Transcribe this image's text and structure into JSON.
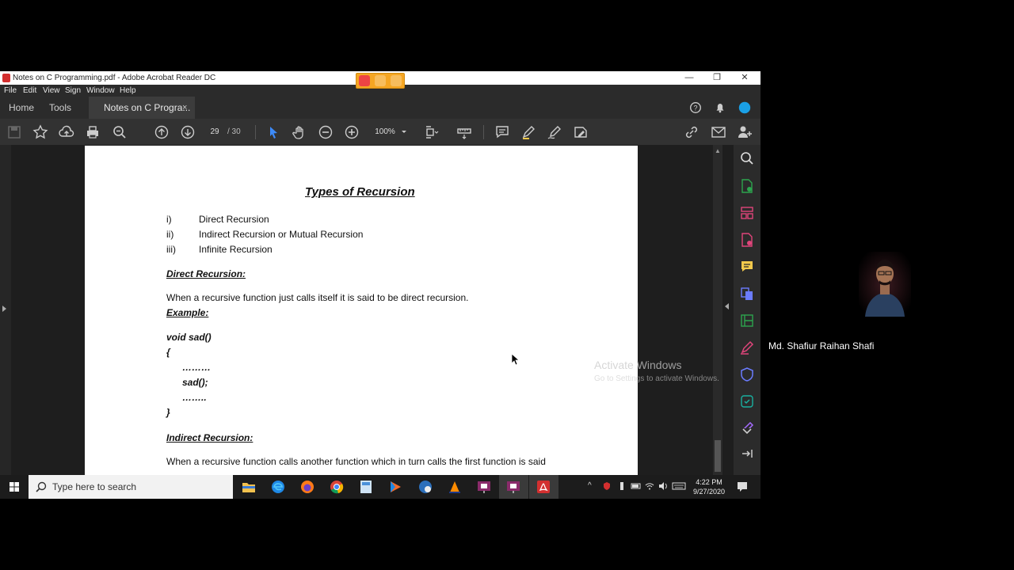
{
  "window": {
    "title": "Notes on C Programming.pdf - Adobe Acrobat Reader DC",
    "minimize": "—",
    "restore": "❐",
    "close": "✕"
  },
  "menu": [
    "File",
    "Edit",
    "View",
    "Sign",
    "Window",
    "Help"
  ],
  "tabs": {
    "home": "Home",
    "tools": "Tools",
    "document": "Notes on C Progra...",
    "close": "×"
  },
  "toolbar": {
    "current_page": "29",
    "page_sep": "/ 30",
    "zoom": "100%"
  },
  "document": {
    "heading": "Types of Recursion",
    "list": [
      {
        "num": "i)",
        "text": "Direct Recursion"
      },
      {
        "num": "ii)",
        "text": "Indirect Recursion or Mutual Recursion"
      },
      {
        "num": "iii)",
        "text": "Infinite Recursion"
      }
    ],
    "direct_title": "Direct Recursion:",
    "direct_desc": "When a recursive function just calls itself it is said to be direct recursion.",
    "example_label": "Example:",
    "code": [
      "void sad()",
      "{",
      "………",
      "sad();",
      "……..",
      "}"
    ],
    "indirect_title": "Indirect Recursion:",
    "indirect_desc": "When a recursive function calls another function which in turn calls the first function is said"
  },
  "watermark": {
    "line1": "Activate Windows",
    "line2": "Go to Settings to activate Windows."
  },
  "taskbar": {
    "search_placeholder": "Type here to search",
    "time": "4:22 PM",
    "date": "9/27/2020"
  },
  "participant": {
    "name": "Md. Shafiur Raihan Shafi"
  },
  "colors": {
    "accent_blue": "#1473e6",
    "acrobat_red": "#d32f2f",
    "rail_green": "#2da44e",
    "rail_pink": "#e0457b"
  }
}
